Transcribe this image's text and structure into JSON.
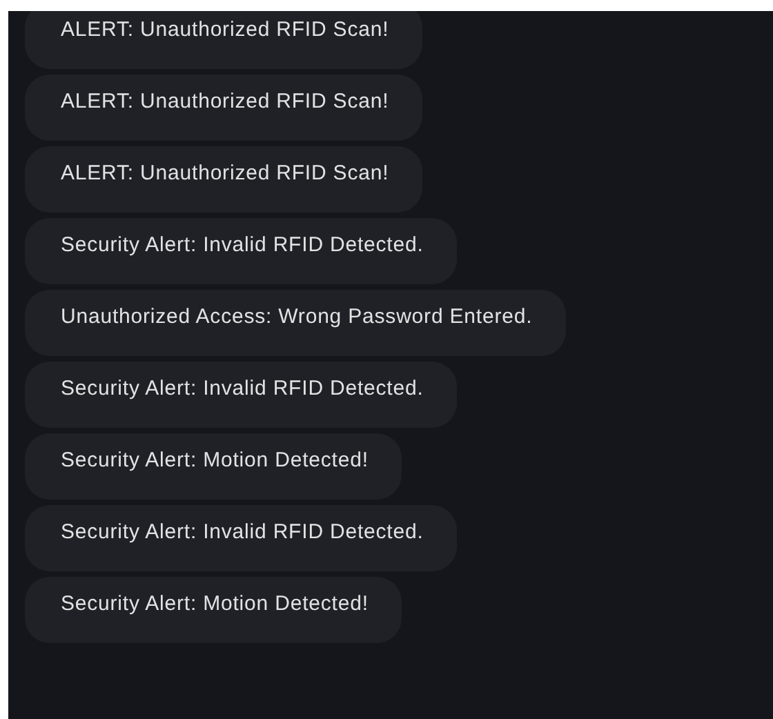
{
  "messages": [
    {
      "text": "ALERT: Unauthorized RFID Scan!"
    },
    {
      "text": "ALERT: Unauthorized RFID Scan!"
    },
    {
      "text": "ALERT: Unauthorized RFID Scan!"
    },
    {
      "text": "Security Alert: Invalid RFID Detected."
    },
    {
      "text": "Unauthorized Access: Wrong Password Entered."
    },
    {
      "text": "Security Alert: Invalid RFID Detected."
    },
    {
      "text": "Security Alert: Motion Detected!"
    },
    {
      "text": "Security Alert: Invalid RFID Detected."
    },
    {
      "text": "Security Alert: Motion Detected!"
    }
  ]
}
